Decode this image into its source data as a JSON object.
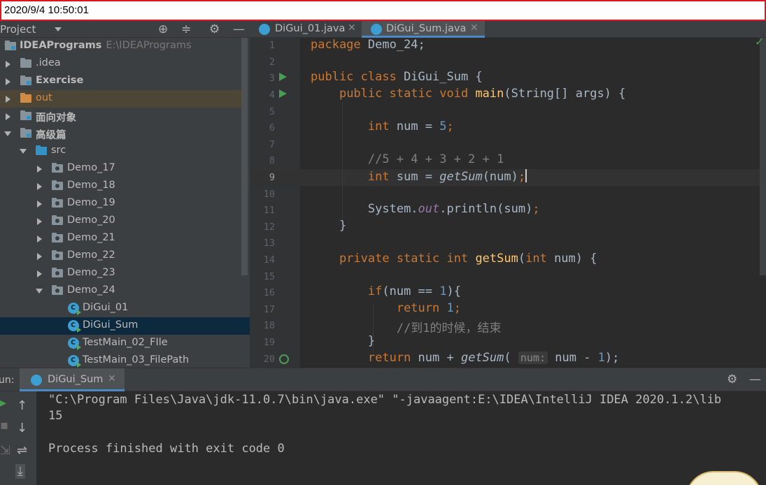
{
  "timestamp": "2020/9/4 10:50:01",
  "project_panel": {
    "title": "Project",
    "root_name": "IDEAPrograms",
    "root_path": "E:\\IDEAPrograms",
    "tree": [
      {
        "label": ".idea"
      },
      {
        "label": "Exercise"
      },
      {
        "label": "out"
      },
      {
        "label": "面向对象"
      },
      {
        "label": "高级篇"
      },
      {
        "label": "src"
      },
      {
        "label": "Demo_17"
      },
      {
        "label": "Demo_18"
      },
      {
        "label": "Demo_19"
      },
      {
        "label": "Demo_20"
      },
      {
        "label": "Demo_21"
      },
      {
        "label": "Demo_22"
      },
      {
        "label": "Demo_23"
      },
      {
        "label": "Demo_24"
      },
      {
        "label": "DiGui_01"
      },
      {
        "label": "DiGui_Sum"
      },
      {
        "label": "TestMain_02_FIle"
      },
      {
        "label": "TestMain_03_FilePath"
      }
    ]
  },
  "editor": {
    "tabs": [
      {
        "label": "DiGui_01.java"
      },
      {
        "label": "DiGui_Sum.java"
      }
    ],
    "line_numbers": [
      "1",
      "2",
      "3",
      "4",
      "5",
      "6",
      "7",
      "8",
      "9",
      "10",
      "11",
      "12",
      "13",
      "14",
      "15",
      "16",
      "17",
      "18",
      "19",
      "20"
    ],
    "code": {
      "l1_kw": "package",
      "l1_rest": " Demo_24;",
      "l3_kw": "public class",
      "l3_rest": " DiGui_Sum {",
      "l4_kw": "public static void",
      "l4_fn": "main",
      "l4_rest": "(String[] args) {",
      "l6_kw": "int",
      "l6_rest": " num = ",
      "l6_num": "5",
      "l6_end": ";",
      "l8_cm": "//5 + 4 + 3 + 2 + 1",
      "l9_kw": "int",
      "l9_rest": " sum = ",
      "l9_call": "getSum",
      "l9_args": "(num)",
      "l9_end": ";",
      "l11_a": "System.",
      "l11_field": "out",
      "l11_b": ".println(sum)",
      "l11_end": ";",
      "l12": "}",
      "l14_kw": "private static int",
      "l14_fn": "getSum",
      "l14_p1": "(",
      "l14_kw2": "int",
      "l14_p2": " num) {",
      "l16_kw": "if",
      "l16_a": "(num == ",
      "l16_num": "1",
      "l16_b": "){",
      "l17_kw": "return",
      "l17_num": "1",
      "l17_end": ";",
      "l18_cm": "//到1的时候，结束",
      "l19": "}",
      "l20_kw": "return",
      "l20_a": " num + ",
      "l20_call": "getSum",
      "l20_p": "(",
      "l20_hint": "num:",
      "l20_b": " num - ",
      "l20_num": "1",
      "l20_end": ");"
    }
  },
  "run_panel": {
    "label": "un:",
    "tab": "DiGui_Sum",
    "output": [
      "\"C:\\Program Files\\Java\\jdk-11.0.7\\bin\\java.exe\" \"-javaagent:E:\\IDEA\\IntelliJ IDEA 2020.1.2\\lib",
      "15",
      "",
      "Process finished with exit code 0"
    ]
  }
}
